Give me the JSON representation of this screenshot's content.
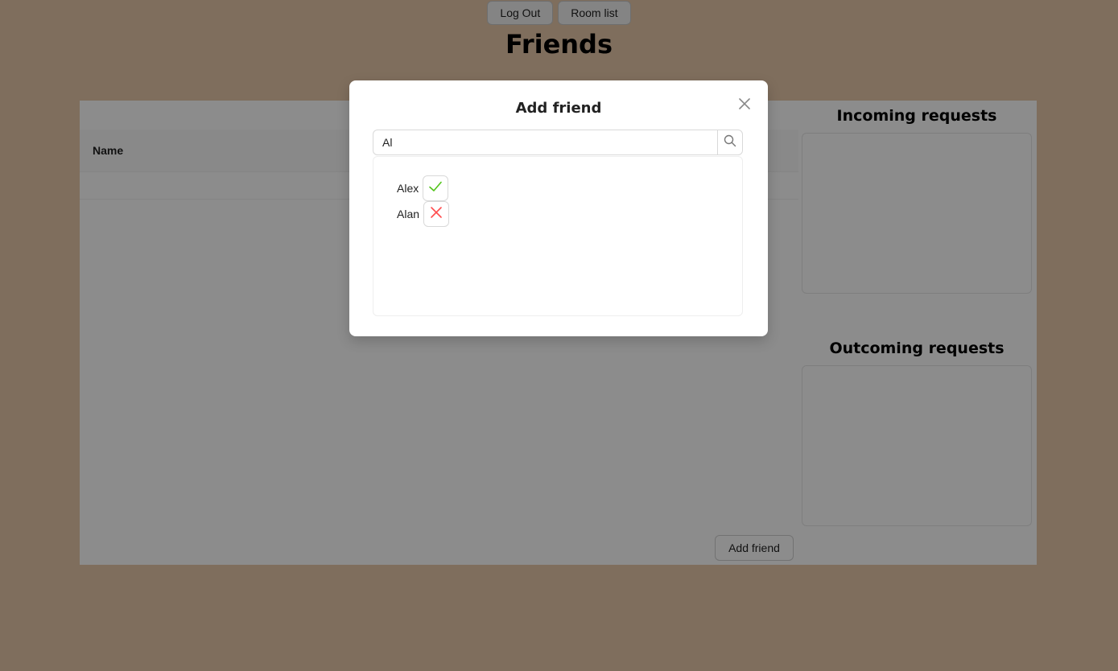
{
  "nav": {
    "logout_label": "Log Out",
    "roomlist_label": "Room list"
  },
  "page": {
    "title": "Friends"
  },
  "table": {
    "columns": [
      "Name"
    ]
  },
  "sidebar": {
    "incoming_title": "Incoming requests",
    "outgoing_title": "Outcoming requests"
  },
  "main": {
    "add_friend_label": "Add friend"
  },
  "modal": {
    "title": "Add friend",
    "search": {
      "value": "Al",
      "placeholder": ""
    },
    "results": [
      {
        "name": "Alex",
        "action_icon": "check-icon",
        "color": "#52c41a"
      },
      {
        "name": "Alan",
        "action_icon": "close-icon",
        "color": "#ff4d4f"
      }
    ]
  },
  "colors": {
    "background": "#e8c9a9",
    "accept": "#52c41a",
    "reject": "#ff4d4f"
  }
}
